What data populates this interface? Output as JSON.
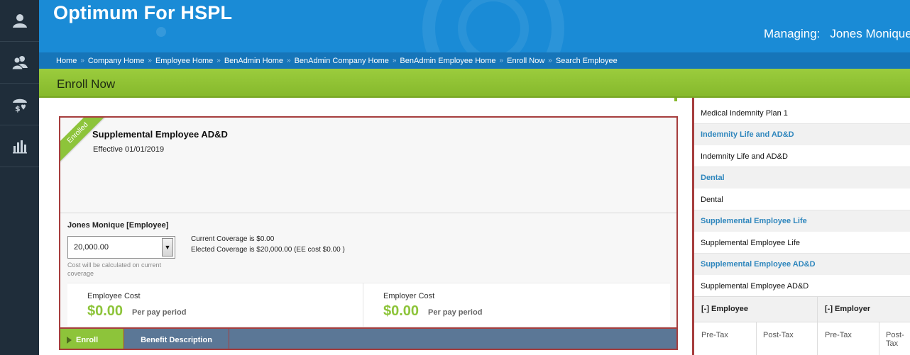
{
  "app": {
    "title": "Optimum For HSPL"
  },
  "header": {
    "managing_label": "Managing:",
    "managing_name": "Jones Monique"
  },
  "breadcrumb": [
    "Home",
    "Company Home",
    "Employee Home",
    "BenAdmin Home",
    "BenAdmin Company Home",
    "BenAdmin Employee Home",
    "Enroll Now",
    "Search Employee"
  ],
  "breadcrumb_separator": "»",
  "page": {
    "title": "Enroll Now"
  },
  "sidebar": {
    "icons": [
      "person-icon",
      "people-icon",
      "benefits-umbrella-icon",
      "reports-chart-icon"
    ]
  },
  "card": {
    "ribbon": "Enrolled",
    "plan_name": "Supplemental Employee AD&D",
    "effective": "Effective 01/01/2019",
    "member": "Jones Monique [Employee]",
    "coverage_select_value": "20,000.00",
    "select_hint": "Cost will be calculated on current coverage",
    "current_coverage": "Current Coverage is $0.00",
    "elected_coverage": "Elected Coverage is $20,000.00 (EE cost $0.00 )",
    "employee_cost_label": "Employee Cost",
    "employee_cost": "$0.00",
    "employer_cost_label": "Employer Cost",
    "employer_cost": "$0.00",
    "per_period": "Per pay period",
    "enroll_button": "Enroll",
    "benefit_description_button": "Benefit Description"
  },
  "plan_list": [
    {
      "type": "plan",
      "label": "Medical Indemnity Plan 1"
    },
    {
      "type": "category",
      "label": "Indemnity Life and AD&D"
    },
    {
      "type": "plan",
      "label": "Indemnity Life and AD&D"
    },
    {
      "type": "category",
      "label": "Dental"
    },
    {
      "type": "plan",
      "label": "Dental"
    },
    {
      "type": "category",
      "label": "Supplemental Employee Life"
    },
    {
      "type": "plan",
      "label": "Supplemental Employee Life"
    },
    {
      "type": "category",
      "label": "Supplemental Employee AD&D"
    },
    {
      "type": "plan",
      "label": "Supplemental Employee AD&D"
    }
  ],
  "summary_table": {
    "employee_header": "[-] Employee",
    "employer_header": "[-] Employer",
    "sub_headers": [
      "Pre-Tax",
      "Post-Tax",
      "Pre-Tax",
      "Post-Tax"
    ]
  },
  "colors": {
    "header_blue": "#1a8bd6",
    "breadcrumb_blue": "#1675b9",
    "accent_green": "#8dc43a",
    "category_blue": "#2e86bd",
    "border_red": "#a63d3d"
  }
}
